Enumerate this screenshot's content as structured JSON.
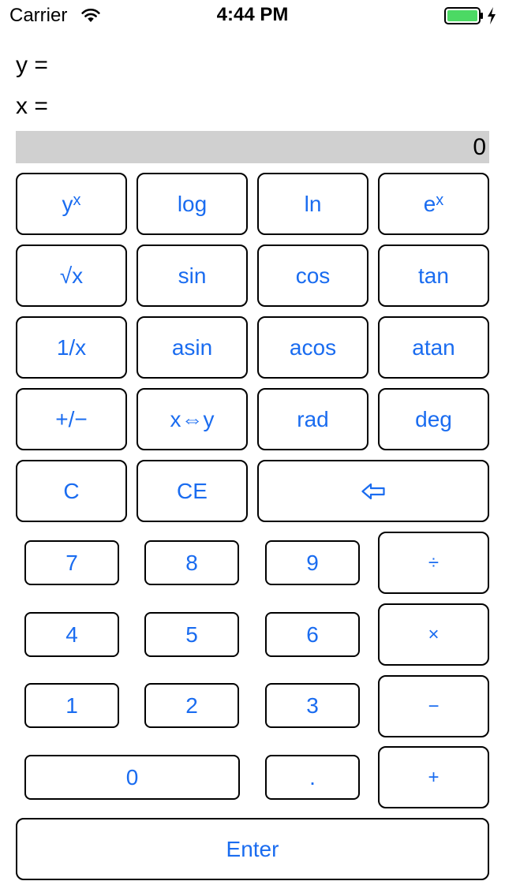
{
  "status_bar": {
    "carrier": "Carrier",
    "time": "4:44 PM",
    "wifi_icon": "wifi-icon",
    "battery_icon": "battery-charging-icon",
    "battery_color": "#4cd964"
  },
  "registers": {
    "y_label": "y =",
    "x_label": "x =",
    "display_value": "0"
  },
  "accent_color": "#1a6cf0",
  "keys": {
    "pow_base": "y",
    "pow_exp": "x",
    "log": "log",
    "ln": "ln",
    "exp_base": "e",
    "exp_exp": "x",
    "sqrt": "√x",
    "sin": "sin",
    "cos": "cos",
    "tan": "tan",
    "recip": "1/x",
    "asin": "asin",
    "acos": "acos",
    "atan": "atan",
    "negate": "+/−",
    "swap": "x⇔y",
    "rad": "rad",
    "deg": "deg",
    "clear": "C",
    "clear_entry": "CE",
    "backspace_icon": "backspace-arrow-icon",
    "seven": "7",
    "eight": "8",
    "nine": "9",
    "divide": "÷",
    "four": "4",
    "five": "5",
    "six": "6",
    "multiply": "×",
    "one": "1",
    "two": "2",
    "three": "3",
    "minus": "−",
    "zero": "0",
    "dot": ".",
    "plus": "+",
    "enter": "Enter"
  }
}
